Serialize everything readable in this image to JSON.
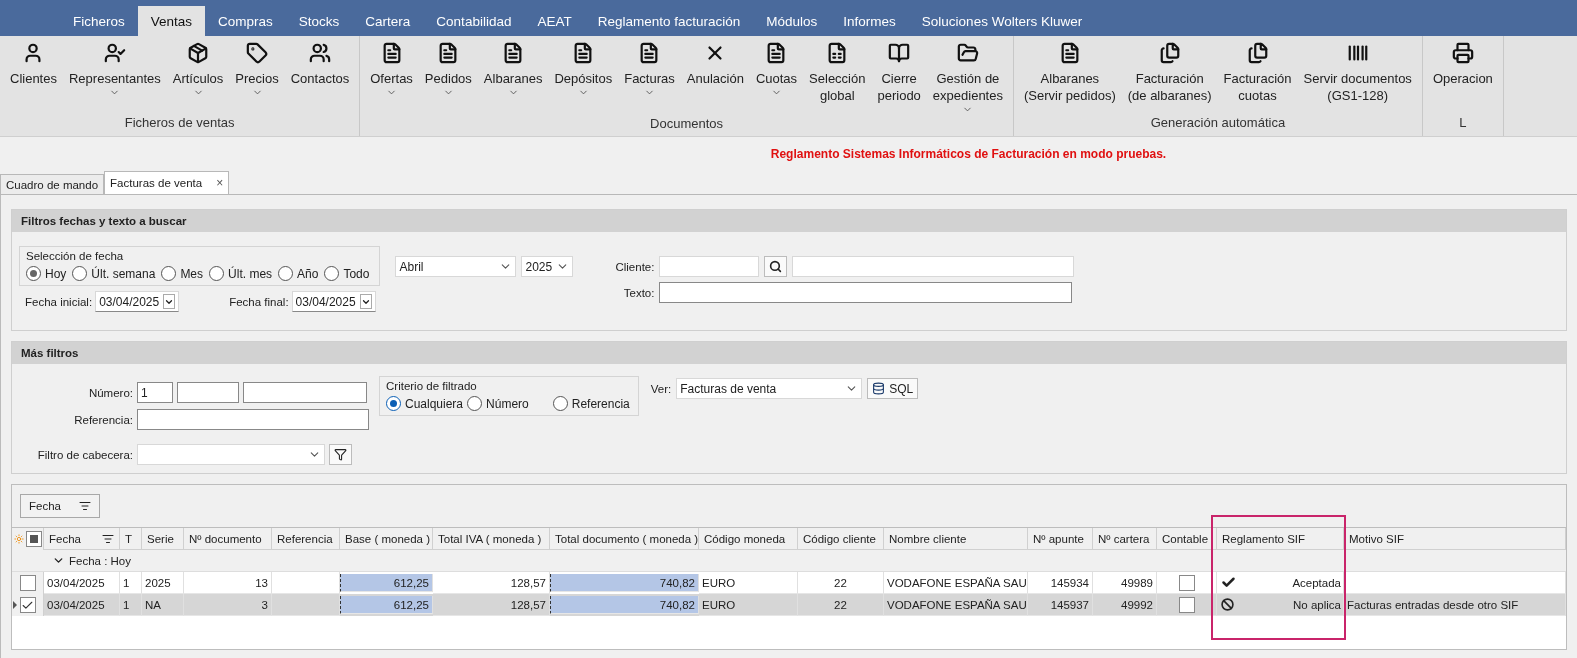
{
  "menu": [
    {
      "label": "Ficheros",
      "selected": false
    },
    {
      "label": "Ventas",
      "selected": true
    },
    {
      "label": "Compras",
      "selected": false
    },
    {
      "label": "Stocks",
      "selected": false
    },
    {
      "label": "Cartera",
      "selected": false
    },
    {
      "label": "Contabilidad",
      "selected": false
    },
    {
      "label": "AEAT",
      "selected": false
    },
    {
      "label": "Reglamento facturación",
      "selected": false
    },
    {
      "label": "Módulos",
      "selected": false
    },
    {
      "label": "Informes",
      "selected": false
    },
    {
      "label": "Soluciones Wolters Kluwer",
      "selected": false
    }
  ],
  "ribbon_groups": [
    {
      "label": "Ficheros de ventas",
      "buttons": [
        {
          "label": "Clientes",
          "dropdown": false
        },
        {
          "label": "Representantes",
          "dropdown": true
        },
        {
          "label": "Artículos",
          "dropdown": true
        },
        {
          "label": "Precios",
          "dropdown": true
        },
        {
          "label": "Contactos",
          "dropdown": false
        }
      ]
    },
    {
      "label": "Documentos",
      "buttons": [
        {
          "label": "Ofertas",
          "dropdown": true
        },
        {
          "label": "Pedidos",
          "dropdown": true
        },
        {
          "label": "Albaranes",
          "dropdown": true
        },
        {
          "label": "Depósitos",
          "dropdown": true
        },
        {
          "label": "Facturas",
          "dropdown": true
        },
        {
          "label": "Anulación",
          "dropdown": false
        },
        {
          "label": "Cuotas",
          "dropdown": true
        },
        {
          "label": "Selección\nglobal",
          "dropdown": false
        },
        {
          "label": "Cierre\nperiodo",
          "dropdown": false
        },
        {
          "label": "Gestión de\nexpedientes",
          "dropdown": true
        }
      ]
    },
    {
      "label": "Generación automática",
      "buttons": [
        {
          "label": "Albaranes\n(Servir pedidos)",
          "dropdown": false
        },
        {
          "label": "Facturación\n(de albaranes)",
          "dropdown": false
        },
        {
          "label": "Facturación\ncuotas",
          "dropdown": false
        },
        {
          "label": "Servir documentos\n(GS1-128)",
          "dropdown": false
        }
      ]
    },
    {
      "label": "L",
      "buttons": [
        {
          "label": "Operacion",
          "dropdown": false
        }
      ]
    }
  ],
  "notice": "Reglamento Sistemas Informáticos de Facturación en modo pruebas.",
  "doc_tabs": [
    {
      "label": "Cuadro de mando",
      "selected": false
    },
    {
      "label": "Facturas de venta",
      "selected": true,
      "close": "×"
    }
  ],
  "date_panel": {
    "title": "Filtros fechas y texto a buscar",
    "date_range": {
      "legend": "Selección de fecha",
      "options": [
        {
          "label": "Hoy",
          "selected": true
        },
        {
          "label": "Últ. semana",
          "selected": false
        },
        {
          "label": "Mes",
          "selected": false
        },
        {
          "label": "Últ. mes",
          "selected": false
        },
        {
          "label": "Año",
          "selected": false
        },
        {
          "label": "Todo",
          "selected": false
        }
      ]
    },
    "start_date": {
      "label": "Fecha inicial:",
      "value": "03/04/2025"
    },
    "end_date": {
      "label": "Fecha final:",
      "value": "03/04/2025"
    },
    "month": {
      "value": "Abril"
    },
    "year": {
      "value": "2025"
    },
    "client": {
      "label": "Cliente:"
    },
    "text": {
      "label": "Texto:"
    }
  },
  "more_panel": {
    "title": "Más filtros",
    "number": {
      "label": "Número:",
      "value": "1"
    },
    "reference": {
      "label": "Referencia:"
    },
    "header_filter": {
      "label": "Filtro de cabecera:"
    },
    "criteria": {
      "legend": "Criterio de filtrado",
      "options": [
        {
          "label": "Cualquiera",
          "selected": true
        },
        {
          "label": "Número",
          "selected": false
        },
        {
          "label": "Referencia",
          "selected": false
        }
      ]
    },
    "view": {
      "label": "Ver:",
      "value": "Facturas de venta"
    },
    "sql_button": "SQL"
  },
  "grid": {
    "group_chip": "Fecha",
    "select_all": {
      "indeterminate": true
    },
    "columns": [
      {
        "label": "Fecha",
        "sorted": true,
        "highlighted": false,
        "annotated": false
      },
      {
        "label": "T",
        "sorted": false,
        "highlighted": false,
        "annotated": false
      },
      {
        "label": "Serie",
        "sorted": false,
        "highlighted": false,
        "annotated": false
      },
      {
        "label": "Nº documento",
        "sorted": false,
        "highlighted": false,
        "annotated": false
      },
      {
        "label": "Referencia",
        "sorted": false,
        "highlighted": false,
        "annotated": false
      },
      {
        "label": "Base ( moneda )",
        "sorted": false,
        "highlighted": true,
        "annotated": false
      },
      {
        "label": "Total IVA ( moneda )",
        "sorted": false,
        "highlighted": false,
        "annotated": false
      },
      {
        "label": "Total documento ( moneda )",
        "sorted": false,
        "highlighted": true,
        "annotated": false
      },
      {
        "label": "Código moneda",
        "sorted": false,
        "highlighted": false,
        "annotated": false
      },
      {
        "label": "Código cliente",
        "sorted": false,
        "highlighted": false,
        "annotated": false
      },
      {
        "label": "Nombre cliente",
        "sorted": false,
        "highlighted": false,
        "annotated": false
      },
      {
        "label": "Nº apunte",
        "sorted": false,
        "highlighted": false,
        "annotated": false
      },
      {
        "label": "Nº cartera",
        "sorted": false,
        "highlighted": false,
        "annotated": false
      },
      {
        "label": "Contable",
        "sorted": false,
        "highlighted": false,
        "annotated": false
      },
      {
        "label": "Reglamento SIF",
        "sorted": false,
        "highlighted": false,
        "annotated": true
      },
      {
        "label": "Motivo SIF",
        "sorted": false,
        "highlighted": false,
        "annotated": false
      }
    ],
    "group_row": "Fecha : Hoy",
    "rows": [
      {
        "selected": false,
        "checked": false,
        "cells": [
          "03/04/2025",
          "1",
          "2025",
          "13",
          null,
          "612,25",
          "128,57",
          "740,82",
          "EURO",
          "22",
          "VODAFONE ESPAÑA SAU",
          "145934",
          "49989",
          {
            "checked": false
          },
          {
            "kind": "accepted",
            "text": "Aceptada"
          },
          null
        ]
      },
      {
        "selected": true,
        "checked": true,
        "cells": [
          "03/04/2025",
          "1",
          "NA",
          "3",
          null,
          "612,25",
          "128,57",
          "740,82",
          "EURO",
          "22",
          "VODAFONE ESPAÑA SAU",
          "145937",
          "49992",
          {
            "checked": false
          },
          {
            "kind": "exempt",
            "text": "No aplica"
          },
          "Facturas entradas desde otro SIF"
        ]
      }
    ]
  }
}
